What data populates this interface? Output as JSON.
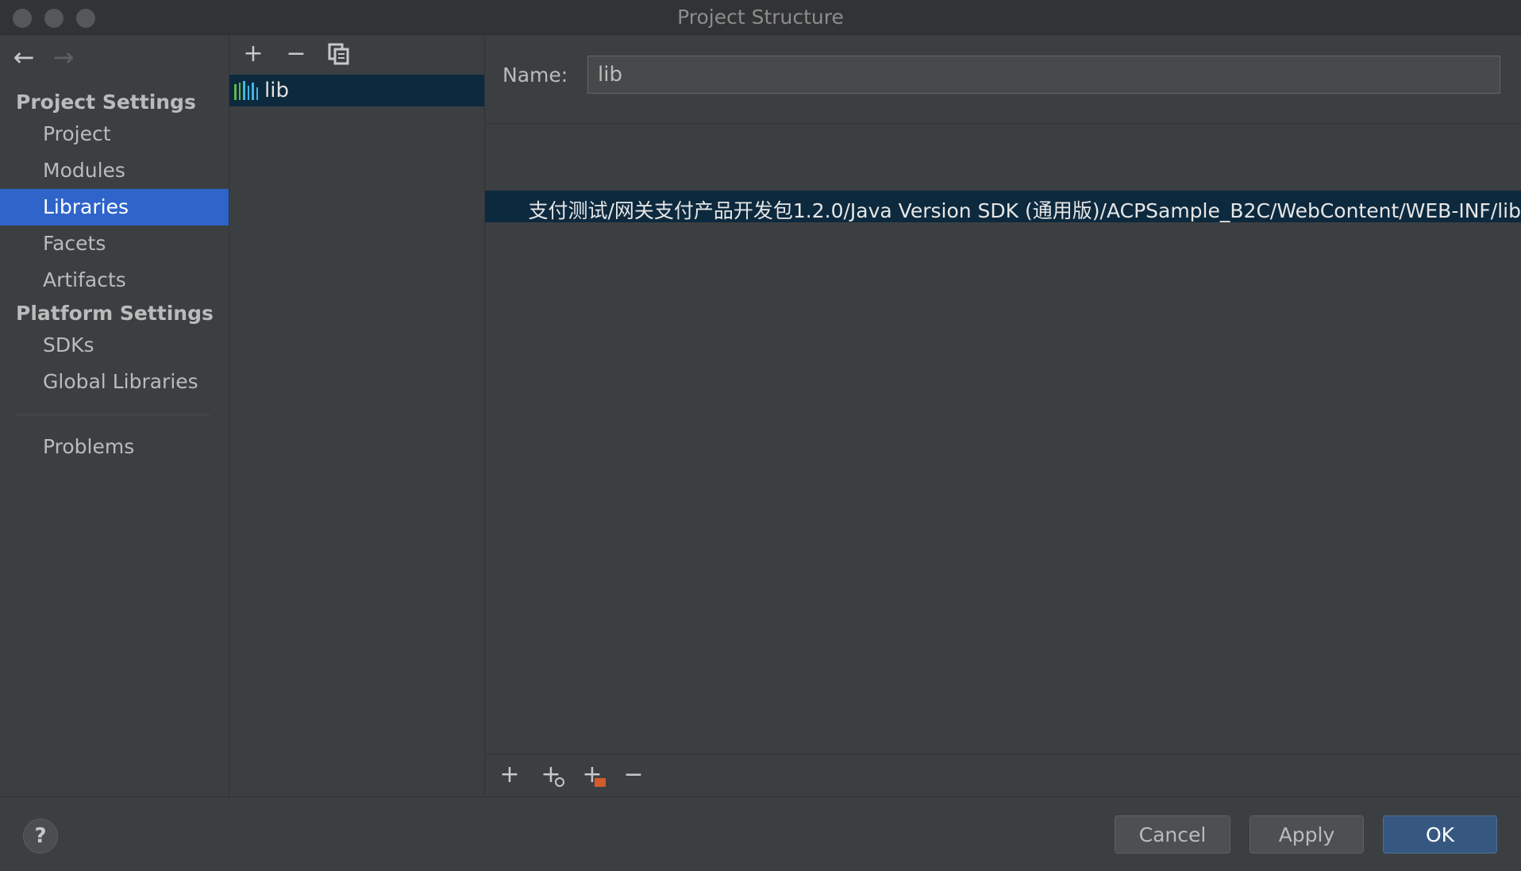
{
  "window": {
    "title": "Project Structure"
  },
  "nav": {
    "back_icon": "←",
    "forward_icon": "→"
  },
  "sidebar": {
    "project_settings_header": "Project Settings",
    "items_project": [
      "Project",
      "Modules",
      "Libraries",
      "Facets",
      "Artifacts"
    ],
    "selected": "Libraries",
    "platform_settings_header": "Platform Settings",
    "items_platform": [
      "SDKs",
      "Global Libraries"
    ],
    "problems": "Problems"
  },
  "library_list": {
    "toolbar": {
      "add": "+",
      "remove": "−",
      "copy_icon": "copy-icon"
    },
    "items": [
      {
        "name": "lib"
      }
    ],
    "icon_colors": [
      "#62b543",
      "#62b543",
      "#40b6e0",
      "#40b6e0",
      "#40b6e0",
      "#40b6e0"
    ]
  },
  "details": {
    "name_label": "Name:",
    "name_value": "lib",
    "roots": [
      "支付测试/网关支付产品开发包1.2.0/Java Version SDK (通用版)/ACPSample_B2C/WebContent/WEB-INF/lib"
    ],
    "roots_toolbar": {
      "add": "+",
      "add_url": "+",
      "add_folder": "+",
      "remove": "−"
    }
  },
  "footer": {
    "help": "?",
    "cancel": "Cancel",
    "apply": "Apply",
    "ok": "OK"
  }
}
